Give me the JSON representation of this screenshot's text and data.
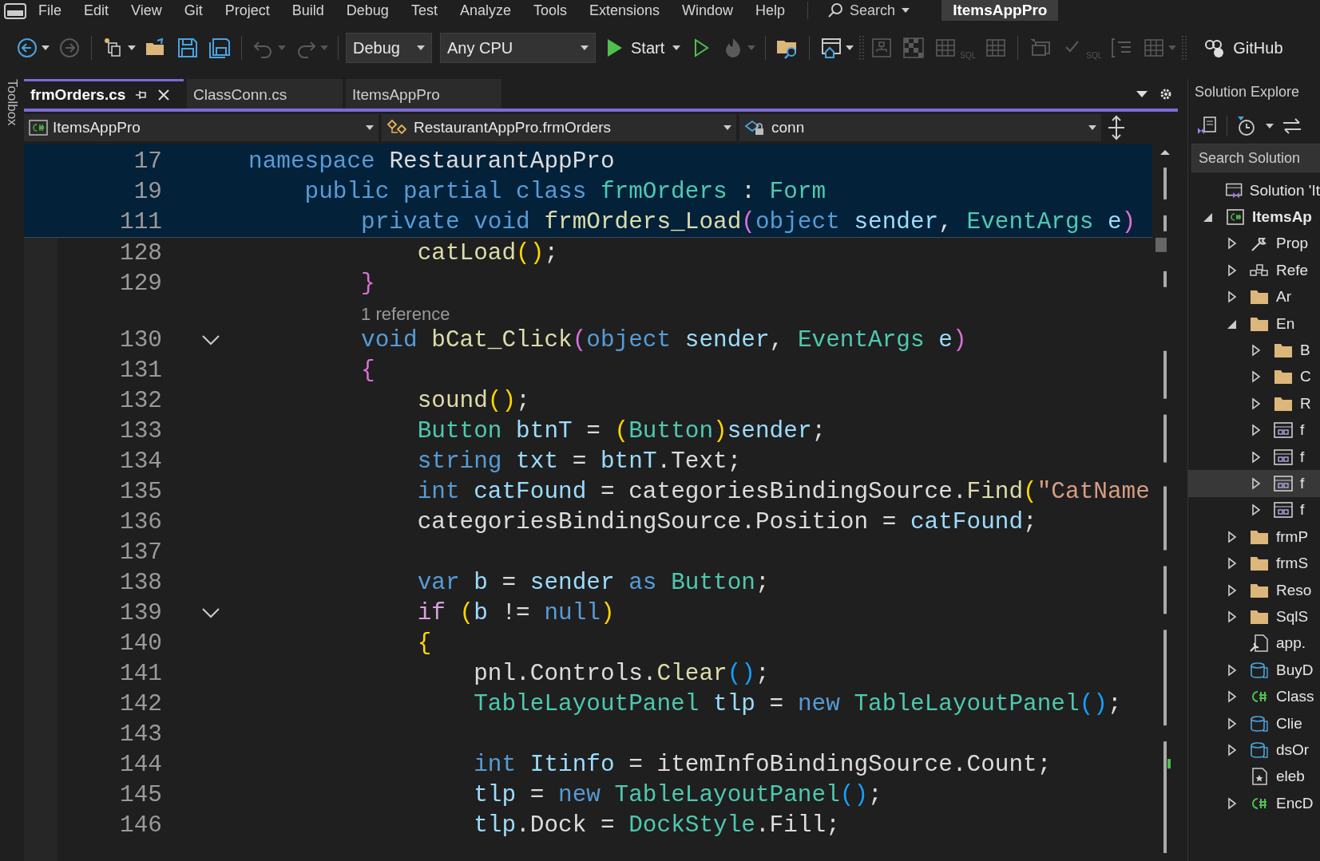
{
  "menu_bar": {
    "items": [
      "File",
      "Edit",
      "View",
      "Git",
      "Project",
      "Build",
      "Debug",
      "Test",
      "Analyze",
      "Tools",
      "Extensions",
      "Window",
      "Help"
    ],
    "search": "Search",
    "title": "ItemsAppPro"
  },
  "toolbar": [
    {
      "kind": "back",
      "disabled": false,
      "menu": true
    },
    {
      "kind": "forward",
      "disabled": true,
      "menu": false
    },
    {
      "kind": "separator"
    },
    {
      "kind": "new-item",
      "disabled": false,
      "menu": true
    },
    {
      "kind": "open-folder",
      "disabled": false,
      "menu": false
    },
    {
      "kind": "save",
      "disabled": false,
      "menu": false
    },
    {
      "kind": "save-all",
      "disabled": false,
      "menu": false
    },
    {
      "kind": "separator"
    },
    {
      "kind": "undo",
      "disabled": true,
      "menu": true
    },
    {
      "kind": "redo",
      "disabled": true,
      "menu": true
    },
    {
      "kind": "separator"
    },
    {
      "kind": "select",
      "value": "Debug"
    },
    {
      "kind": "select",
      "value": "Any CPU"
    },
    {
      "kind": "start",
      "label": "Start",
      "menu": true
    },
    {
      "kind": "run-outline",
      "disabled": false,
      "menu": false
    },
    {
      "kind": "hot-reload",
      "disabled": true,
      "menu": true
    },
    {
      "kind": "separator"
    },
    {
      "kind": "folder-search",
      "disabled": false,
      "menu": false
    },
    {
      "kind": "separator"
    },
    {
      "kind": "window-home",
      "disabled": false,
      "menu": true
    },
    {
      "kind": "grip"
    },
    {
      "kind": "diagram",
      "disabled": true,
      "menu": false
    },
    {
      "kind": "checker",
      "disabled": true,
      "menu": false
    },
    {
      "kind": "sql",
      "disabled": true,
      "menu": false,
      "label": "SQL"
    },
    {
      "kind": "grid",
      "disabled": true,
      "menu": false
    },
    {
      "kind": "separator"
    },
    {
      "kind": "screen",
      "disabled": true,
      "menu": false
    },
    {
      "kind": "sql-check",
      "disabled": true,
      "menu": false,
      "label": "SQL"
    },
    {
      "kind": "outline",
      "disabled": true,
      "menu": false
    },
    {
      "kind": "table-add",
      "disabled": true,
      "menu": true
    },
    {
      "kind": "grip"
    },
    {
      "kind": "github",
      "label": "GitHub"
    }
  ],
  "toolbox": "Toolbox",
  "tabs": [
    {
      "label": "frmOrders.cs",
      "selected": true,
      "pinned": true
    },
    {
      "label": "ClassConn.cs",
      "selected": false
    },
    {
      "label": "ItemsAppPro",
      "selected": false
    }
  ],
  "nav_bar": {
    "project": "ItemsAppPro",
    "type": "RestaurantAppPro.frmOrders",
    "member": "conn"
  },
  "sticky_lines": [
    {
      "number": "17",
      "tokens": [
        {
          "text": "namespace",
          "kind": "kw"
        },
        {
          "text": " RestaurantAppPro",
          "kind": "plain"
        }
      ]
    },
    {
      "number": "19",
      "tokens": [
        {
          "text": "    public partial class",
          "kind": "kw"
        },
        {
          "text": " frmOrders",
          "kind": "type"
        },
        {
          "text": " : ",
          "kind": "plain"
        },
        {
          "text": "Form",
          "kind": "type"
        }
      ]
    },
    {
      "number": "111",
      "tokens": [
        {
          "text": "        private void",
          "kind": "kw"
        },
        {
          "text": " frmOrders_Load",
          "kind": "method"
        },
        {
          "text": "(",
          "kind": "b2"
        },
        {
          "text": "object",
          "kind": "kw"
        },
        {
          "text": " sender",
          "kind": "local"
        },
        {
          "text": ", ",
          "kind": "plain"
        },
        {
          "text": "EventArgs",
          "kind": "type"
        },
        {
          "text": " e",
          "kind": "local"
        },
        {
          "text": ")",
          "kind": "b2"
        }
      ]
    }
  ],
  "code_lines": [
    {
      "number": "128",
      "tokens": [
        {
          "text": "            catLoad",
          "kind": "method"
        },
        {
          "text": "()",
          "kind": "b1"
        },
        {
          "text": ";",
          "kind": "plain"
        }
      ]
    },
    {
      "number": "129",
      "tokens": [
        {
          "text": "        }",
          "kind": "b2"
        }
      ]
    },
    {
      "kind": "codelens",
      "text": "1 reference"
    },
    {
      "number": "130",
      "collapsed": false,
      "tokens": [
        {
          "text": "        void",
          "kind": "kw"
        },
        {
          "text": " bCat_Click",
          "kind": "method"
        },
        {
          "text": "(",
          "kind": "b2"
        },
        {
          "text": "object",
          "kind": "kw"
        },
        {
          "text": " sender",
          "kind": "local"
        },
        {
          "text": ", ",
          "kind": "plain"
        },
        {
          "text": "EventArgs",
          "kind": "type"
        },
        {
          "text": " e",
          "kind": "local"
        },
        {
          "text": ")",
          "kind": "b2"
        }
      ]
    },
    {
      "number": "131",
      "tokens": [
        {
          "text": "        {",
          "kind": "b2"
        }
      ]
    },
    {
      "number": "132",
      "tokens": [
        {
          "text": "            sound",
          "kind": "method"
        },
        {
          "text": "()",
          "kind": "b1"
        },
        {
          "text": ";",
          "kind": "plain"
        }
      ]
    },
    {
      "number": "133",
      "tokens": [
        {
          "text": "            Button",
          "kind": "type"
        },
        {
          "text": " btnT",
          "kind": "local"
        },
        {
          "text": " = ",
          "kind": "plain"
        },
        {
          "text": "(",
          "kind": "b1"
        },
        {
          "text": "Button",
          "kind": "type"
        },
        {
          "text": ")",
          "kind": "b1"
        },
        {
          "text": "sender",
          "kind": "local"
        },
        {
          "text": ";",
          "kind": "plain"
        }
      ]
    },
    {
      "number": "134",
      "tokens": [
        {
          "text": "            string",
          "kind": "kw"
        },
        {
          "text": " txt",
          "kind": "local"
        },
        {
          "text": " = ",
          "kind": "plain"
        },
        {
          "text": "btnT",
          "kind": "local"
        },
        {
          "text": ".Text;",
          "kind": "plain"
        }
      ]
    },
    {
      "number": "135",
      "tokens": [
        {
          "text": "            int",
          "kind": "kw"
        },
        {
          "text": " catFound",
          "kind": "local"
        },
        {
          "text": " = categoriesBindingSource.",
          "kind": "plain"
        },
        {
          "text": "Find",
          "kind": "method"
        },
        {
          "text": "(",
          "kind": "b1"
        },
        {
          "text": "\"CatName",
          "kind": "str"
        }
      ]
    },
    {
      "number": "136",
      "tokens": [
        {
          "text": "            categoriesBindingSource.Position = ",
          "kind": "plain"
        },
        {
          "text": "catFound",
          "kind": "local"
        },
        {
          "text": ";",
          "kind": "plain"
        }
      ]
    },
    {
      "number": "137"
    },
    {
      "number": "138",
      "tokens": [
        {
          "text": "            var",
          "kind": "kw"
        },
        {
          "text": " b",
          "kind": "local"
        },
        {
          "text": " = ",
          "kind": "plain"
        },
        {
          "text": "sender",
          "kind": "local"
        },
        {
          "text": " as",
          "kind": "kw"
        },
        {
          "text": " Button",
          "kind": "type"
        },
        {
          "text": ";",
          "kind": "plain"
        }
      ]
    },
    {
      "number": "139",
      "collapsed": false,
      "tokens": [
        {
          "text": "            if",
          "kind": "ctl"
        },
        {
          "text": " (",
          "kind": "b1"
        },
        {
          "text": "b",
          "kind": "local"
        },
        {
          "text": " != ",
          "kind": "plain"
        },
        {
          "text": "null",
          "kind": "kw"
        },
        {
          "text": ")",
          "kind": "b1"
        }
      ]
    },
    {
      "number": "140",
      "tokens": [
        {
          "text": "            {",
          "kind": "b1"
        }
      ]
    },
    {
      "number": "141",
      "tokens": [
        {
          "text": "                pnl.Controls.",
          "kind": "plain"
        },
        {
          "text": "Clear",
          "kind": "method"
        },
        {
          "text": "()",
          "kind": "b3"
        },
        {
          "text": ";",
          "kind": "plain"
        }
      ]
    },
    {
      "number": "142",
      "tokens": [
        {
          "text": "                TableLayoutPanel",
          "kind": "type"
        },
        {
          "text": " tlp",
          "kind": "local"
        },
        {
          "text": " = ",
          "kind": "plain"
        },
        {
          "text": "new",
          "kind": "kw"
        },
        {
          "text": " TableLayoutPanel",
          "kind": "type"
        },
        {
          "text": "()",
          "kind": "b3"
        },
        {
          "text": ";",
          "kind": "plain"
        }
      ]
    },
    {
      "number": "143"
    },
    {
      "number": "144",
      "tokens": [
        {
          "text": "                int",
          "kind": "kw"
        },
        {
          "text": " Itinfo",
          "kind": "local"
        },
        {
          "text": " = itemInfoBindingSource.Count;",
          "kind": "plain"
        }
      ]
    },
    {
      "number": "145",
      "tokens": [
        {
          "text": "                tlp",
          "kind": "local"
        },
        {
          "text": " = ",
          "kind": "plain"
        },
        {
          "text": "new",
          "kind": "kw"
        },
        {
          "text": " TableLayoutPanel",
          "kind": "type"
        },
        {
          "text": "()",
          "kind": "b3"
        },
        {
          "text": ";",
          "kind": "plain"
        }
      ]
    },
    {
      "number": "146",
      "tokens": [
        {
          "text": "                tlp",
          "kind": "local"
        },
        {
          "text": ".Dock = ",
          "kind": "plain"
        },
        {
          "text": "DockStyle",
          "kind": "type"
        },
        {
          "text": ".Fill;",
          "kind": "plain"
        }
      ]
    }
  ],
  "solution_explorer": {
    "title": "Solution Explore",
    "search": {
      "placeholder": "Search Solution"
    },
    "tree": [
      {
        "label": "Solution 'It",
        "kind": "solution",
        "selected": false
      },
      {
        "label": "ItemsAp",
        "kind": "csproj",
        "bold": true,
        "expanded": true,
        "selected": false,
        "children": [
          {
            "label": "Prop",
            "kind": "wrench",
            "expanded": false,
            "selected": false
          },
          {
            "label": "Refe",
            "kind": "refs",
            "expanded": false,
            "selected": false
          },
          {
            "label": "Ar",
            "kind": "folder",
            "expanded": false,
            "selected": false
          },
          {
            "label": "En",
            "kind": "folder",
            "expanded": true,
            "selected": false,
            "children": [
              {
                "label": "B",
                "kind": "folder",
                "expanded": false,
                "selected": false
              },
              {
                "label": "C",
                "kind": "folder",
                "expanded": false,
                "selected": false
              },
              {
                "label": "R",
                "kind": "folder",
                "expanded": false,
                "selected": false
              },
              {
                "label": "f",
                "kind": "form",
                "expanded": false,
                "selected": false
              },
              {
                "label": "f",
                "kind": "form",
                "expanded": false,
                "selected": false
              },
              {
                "label": "f",
                "kind": "form",
                "expanded": false,
                "selected": true
              },
              {
                "label": "f",
                "kind": "form",
                "expanded": false,
                "selected": false
              }
            ]
          },
          {
            "label": "frmP",
            "kind": "folder",
            "expanded": false,
            "selected": false
          },
          {
            "label": "frmS",
            "kind": "folder",
            "expanded": false,
            "selected": false
          },
          {
            "label": "Reso",
            "kind": "folder",
            "expanded": false,
            "selected": false
          },
          {
            "label": "SqlS",
            "kind": "folder",
            "expanded": false,
            "selected": false
          },
          {
            "label": "app.",
            "kind": "config",
            "selected": false
          },
          {
            "label": "BuyD",
            "kind": "dataset",
            "expanded": false,
            "selected": false
          },
          {
            "label": "Class",
            "kind": "cs",
            "expanded": false,
            "selected": false
          },
          {
            "label": "Clie",
            "kind": "dataset",
            "expanded": false,
            "selected": false
          },
          {
            "label": "dsOr",
            "kind": "dataset",
            "expanded": false,
            "selected": false
          },
          {
            "label": "eleb",
            "kind": "resource",
            "selected": false
          },
          {
            "label": "EncD",
            "kind": "cs",
            "expanded": false,
            "selected": false
          }
        ]
      }
    ]
  }
}
